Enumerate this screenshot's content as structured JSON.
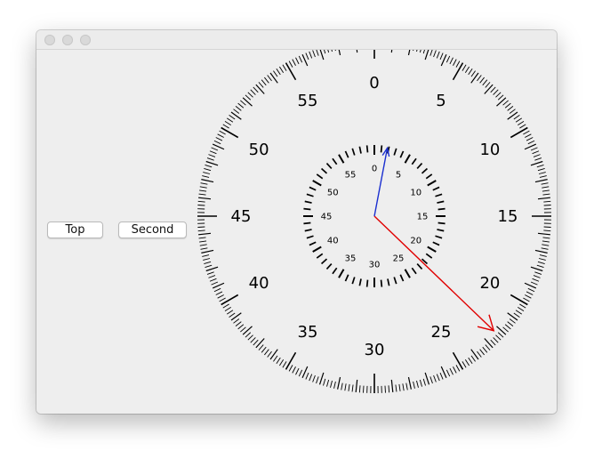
{
  "window": {
    "traffic_lights": [
      "close",
      "minimize",
      "zoom"
    ]
  },
  "buttons": {
    "top_label": "Top",
    "second_label": "Second"
  },
  "stopwatch": {
    "outer_dial_labels": [
      "0",
      "5",
      "10",
      "15",
      "20",
      "25",
      "30",
      "35",
      "40",
      "45",
      "50",
      "55"
    ],
    "inner_dial_labels": [
      "0",
      "5",
      "10",
      "15",
      "20",
      "25",
      "30",
      "35",
      "40",
      "45",
      "50",
      "55"
    ],
    "second_hand_value": 22.3,
    "minute_hand_value": 1.8,
    "colors": {
      "second_hand": "#e00000",
      "minute_hand": "#1a2fd0",
      "ticks": "#000000"
    }
  }
}
